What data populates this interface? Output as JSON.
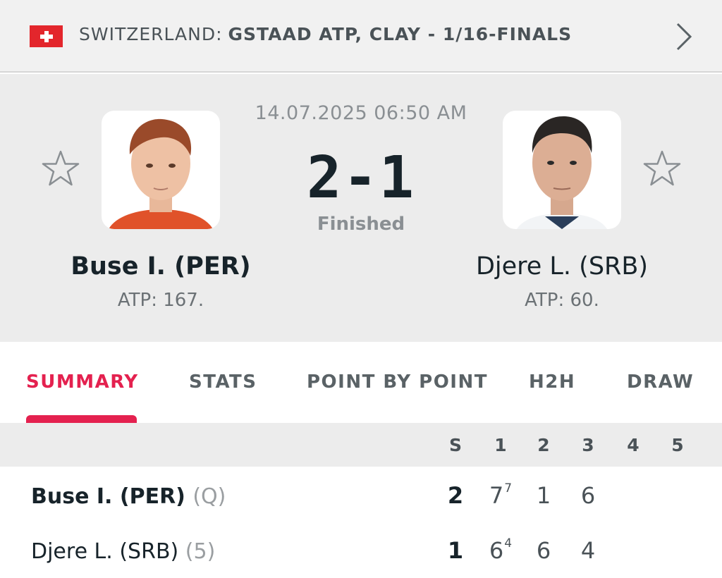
{
  "header": {
    "country": "SWITZERLAND:",
    "tournament": "GSTAAD ATP, CLAY - 1/16-FINALS"
  },
  "match": {
    "datetime": "14.07.2025 06:50 AM",
    "score": "2-1",
    "status": "Finished",
    "home": {
      "name": "Buse I. (PER)",
      "rank": "ATP: 167."
    },
    "away": {
      "name": "Djere L. (SRB)",
      "rank": "ATP: 60."
    }
  },
  "tabs": [
    "SUMMARY",
    "STATS",
    "POINT BY POINT",
    "H2H",
    "DRAW"
  ],
  "table": {
    "columns": [
      "S",
      "1",
      "2",
      "3",
      "4",
      "5"
    ],
    "rows": [
      {
        "name": "Buse I. (PER)",
        "seed": "(Q)",
        "sets": "2",
        "s1": "7",
        "s1_tb": "7",
        "s2": "1",
        "s3": "6"
      },
      {
        "name": "Djere L. (SRB)",
        "seed": "(5)",
        "sets": "1",
        "s1": "6",
        "s1_tb": "4",
        "s2": "6",
        "s3": "4"
      }
    ]
  },
  "colors": {
    "accent": "#e4214f",
    "flag": "#e3262c",
    "panel": "#ececec"
  }
}
